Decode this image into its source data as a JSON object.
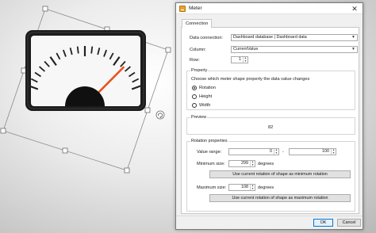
{
  "dialog": {
    "title": "Meter",
    "close_glyph": "✕",
    "tab_label": "Connection",
    "data_connection_label": "Data connection:",
    "data_connection_value": "Dashboard database | Dashboard data",
    "column_label": "Column:",
    "column_value": "CurrentValue",
    "row_label": "Row:",
    "row_value": "1",
    "property_group_title": "Property",
    "property_hint": "Choose which meter shape property the data value changes",
    "property_options": [
      "Rotation",
      "Height",
      "Width"
    ],
    "property_selected": "Rotation",
    "preview_group_title": "Preview",
    "preview_value": "82",
    "rotation_group_title": "Rotation properties",
    "value_range_label": "Value range:",
    "value_range_min": "0",
    "value_range_dash": "-",
    "value_range_max": "100",
    "min_size_label": "Minimum size:",
    "min_size_value": "299",
    "min_size_unit": "degrees",
    "min_rotation_button": "Use current rotation of shape as minimum rotation",
    "max_size_label": "Maximum size:",
    "max_size_value": "108",
    "max_size_unit": "degrees",
    "max_rotation_button": "Use current rotation of shape as maximum rotation",
    "ok_label": "OK",
    "cancel_label": "Cancel"
  },
  "meter": {
    "needle_color": "#e8541c",
    "face_color": "#f7f7f7",
    "bezel_color": "#1c1c1c",
    "needle_level_percent": 82
  },
  "colors": {
    "accent": "#0078d7",
    "title_icon": "#e8a326"
  }
}
